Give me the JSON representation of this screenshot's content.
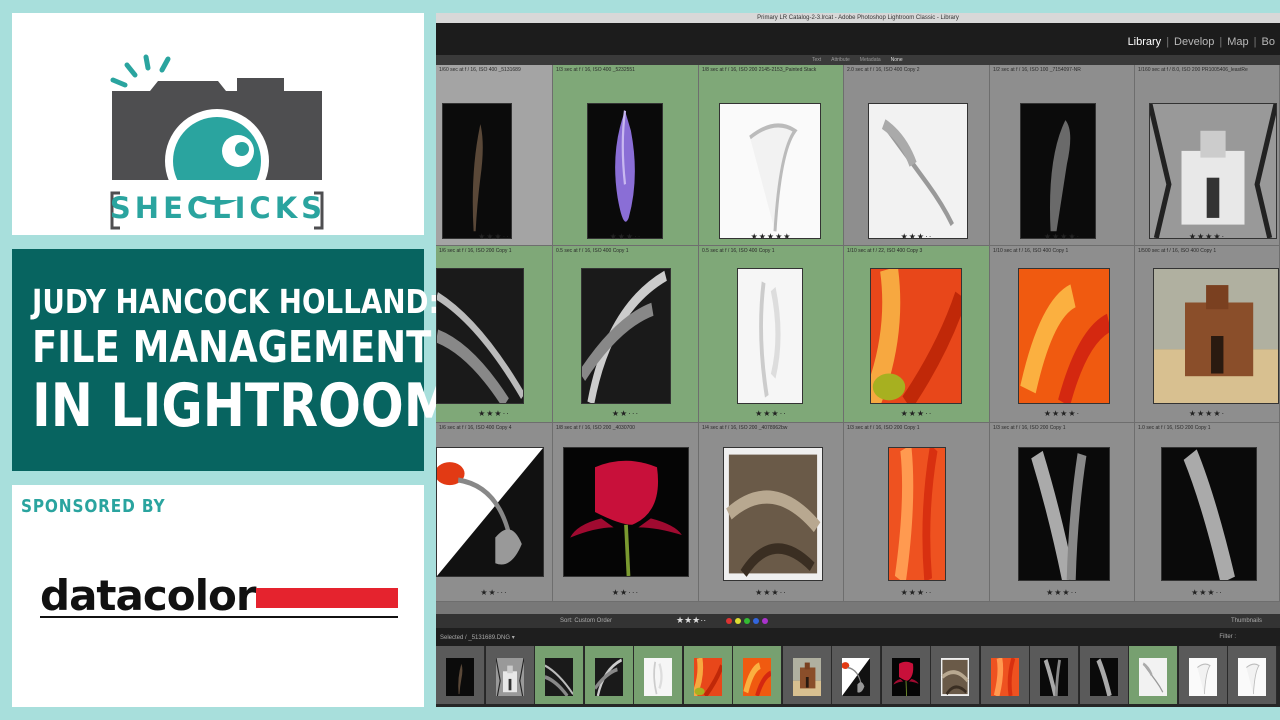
{
  "brand": {
    "name": "SHECLICKS",
    "accent": "#2aa49f"
  },
  "title": {
    "line1": "JUDY HANCOCK HOLLAND:",
    "line2": "FILE MANAGEMENT",
    "line3": "IN LIGHTROOM",
    "background": "#076460"
  },
  "sponsor": {
    "label": "SPONSORED BY",
    "name": "datacolor",
    "bar_color": "#e5232e"
  },
  "lightroom": {
    "window_title": "Primary LR Catalog-2-3.lrcat - Adobe Photoshop Lightroom Classic - Library",
    "modules": [
      "Library",
      "Develop",
      "Map",
      "Bo"
    ],
    "active_module": "Library",
    "filter_tabs": [
      "Text",
      "Attribute",
      "Metadata",
      "None"
    ],
    "active_filter": "None",
    "grid": [
      {
        "meta": "1/60 sec at f / 16, ISO 400  _5131689",
        "stars": "★★★·· ",
        "selected": false
      },
      {
        "meta": "1/3 sec at f / 16, ISO 400  _5232551",
        "stars": "★★★··",
        "selected": true
      },
      {
        "meta": "1/8 sec at f / 16, ISO 200  2145-2153_Painted Stack",
        "stars": "★★★★★",
        "selected": true
      },
      {
        "meta": "2.0 sec at f / 16, ISO 400  Copy 2",
        "stars": "★★★··",
        "selected": false
      },
      {
        "meta": "1/2 sec at f / 16, ISO 100  _7154097-NR",
        "stars": "★★★★·",
        "selected": false
      },
      {
        "meta": "1/160 sec at f / 8.0, ISO 200  PR1005406_leastRe",
        "stars": "★★★★·",
        "selected": false
      },
      {
        "meta": "1/6 sec at f / 16, ISO 200  Copy 1",
        "stars": "★★★··",
        "selected": true
      },
      {
        "meta": "0.5 sec at f / 16, ISO 400  Copy 1",
        "stars": "★★···",
        "selected": true
      },
      {
        "meta": "0.5 sec at f / 16, ISO 400  Copy 1",
        "stars": "★★★··",
        "selected": true
      },
      {
        "meta": "1/10 sec at f / 22, ISO 400  Copy 3",
        "stars": "★★★··",
        "selected": true
      },
      {
        "meta": "1/10 sec at f / 16, ISO 400  Copy 1",
        "stars": "★★★★·",
        "selected": false
      },
      {
        "meta": "1/500 sec at f / 16, ISO 400  Copy 1",
        "stars": "★★★★·",
        "selected": false
      },
      {
        "meta": "1/6 sec at f / 16, ISO 400  Copy 4",
        "stars": "★★···",
        "selected": false
      },
      {
        "meta": "1/8 sec at f / 16, ISO 200  _4030700",
        "stars": "★★···",
        "selected": false
      },
      {
        "meta": "1/4 sec at f / 16, ISO 200  _4078962bw",
        "stars": "★★★··",
        "selected": false
      },
      {
        "meta": "1/3 sec at f / 16, ISO 200  Copy 1",
        "stars": "★★★··",
        "selected": false
      },
      {
        "meta": "1/3 sec at f / 16, ISO 200  Copy 1",
        "stars": "★★★··",
        "selected": false
      },
      {
        "meta": "1.0 sec at f / 16, ISO 200  Copy 1",
        "stars": "★★★··",
        "selected": false
      }
    ],
    "toolbar": {
      "sort_label": "Sort:",
      "sort_value": "Custom Order",
      "stars": "★★★··",
      "thumbnails_label": "Thumbnails"
    },
    "filmstrip": {
      "selected_text": "Selected / _5131689.DNG ▾",
      "filter_label": "Filter :"
    }
  }
}
